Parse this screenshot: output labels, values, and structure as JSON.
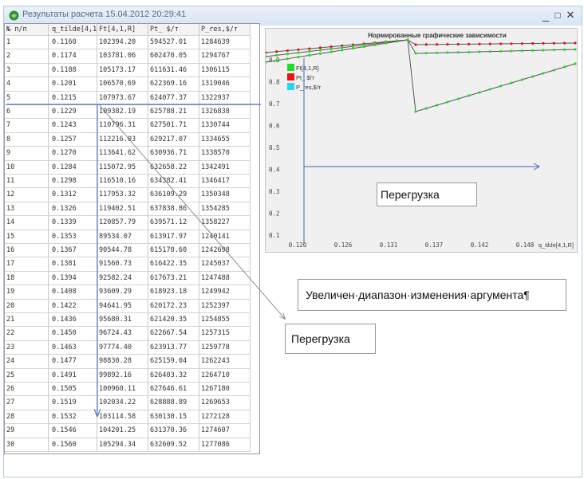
{
  "window": {
    "title": "Результаты расчета 15.04.2012 20:29:41",
    "minimize": "_",
    "maximize": "□",
    "close": "✕"
  },
  "colors": {
    "ft": "#22dd22",
    "pt": "#ee1111",
    "pres": "#22d8ee",
    "chart_bg": "#f0f0f0",
    "line": "#555555"
  },
  "table": {
    "headers": [
      "№ п/п",
      "q_tilde[4,1,R]",
      "Ft[4,1,R]",
      "Pt_ $/т",
      "P_res,$/т"
    ],
    "rows": [
      [
        "1",
        "0.1160",
        "102394.20",
        "594527.01",
        "1284639"
      ],
      [
        "2",
        "0.1174",
        "103781.06",
        "602470.05",
        "1294767"
      ],
      [
        "3",
        "0.1188",
        "105173.17",
        "611631.46",
        "1306115"
      ],
      [
        "4",
        "0.1201",
        "106570.69",
        "622369.16",
        "1319046"
      ],
      [
        "5",
        "0.1215",
        "107973.67",
        "624077.37",
        "1322937"
      ],
      [
        "6",
        "0.1229",
        "109382.19",
        "625788.21",
        "1326838"
      ],
      [
        "7",
        "0.1243",
        "110796.31",
        "627501.71",
        "1330744"
      ],
      [
        "8",
        "0.1257",
        "112216.03",
        "629217.07",
        "1334655"
      ],
      [
        "9",
        "0.1270",
        "113641.62",
        "630936.71",
        "1338570"
      ],
      [
        "10",
        "0.1284",
        "115072.95",
        "632658.22",
        "1342491"
      ],
      [
        "11",
        "0.1298",
        "116510.16",
        "634382.41",
        "1346417"
      ],
      [
        "12",
        "0.1312",
        "117953.32",
        "636109.29",
        "1350348"
      ],
      [
        "13",
        "0.1326",
        "119402.51",
        "637838.86",
        "1354285"
      ],
      [
        "14",
        "0.1339",
        "120857.79",
        "639571.12",
        "1358227"
      ],
      [
        "15",
        "0.1353",
        "89534.07",
        "613917.97",
        "1240141"
      ],
      [
        "16",
        "0.1367",
        "90544.78",
        "615170.60",
        "1242698"
      ],
      [
        "17",
        "0.1381",
        "91560.73",
        "616422.35",
        "1245037"
      ],
      [
        "18",
        "0.1394",
        "92582.24",
        "617673.21",
        "1247488"
      ],
      [
        "19",
        "0.1408",
        "93609.29",
        "618923.18",
        "1249942"
      ],
      [
        "20",
        "0.1422",
        "94641.95",
        "620172.23",
        "1252397"
      ],
      [
        "21",
        "0.1436",
        "95680.31",
        "621420.35",
        "1254855"
      ],
      [
        "22",
        "0.1450",
        "96724.43",
        "622667.54",
        "1257315"
      ],
      [
        "23",
        "0.1463",
        "97774.40",
        "623913.77",
        "1259778"
      ],
      [
        "24",
        "0.1477",
        "98830.28",
        "625159.04",
        "1262243"
      ],
      [
        "25",
        "0.1491",
        "99892.16",
        "626403.32",
        "1264710"
      ],
      [
        "26",
        "0.1505",
        "100960.11",
        "627646.61",
        "1267180"
      ],
      [
        "27",
        "0.1519",
        "102034.22",
        "628888.89",
        "1269653"
      ],
      [
        "28",
        "0.1532",
        "103114.58",
        "630130.15",
        "1272128"
      ],
      [
        "29",
        "0.1546",
        "104201.25",
        "631370.36",
        "1274607"
      ],
      [
        "30",
        "0.1560",
        "105294.34",
        "632609.52",
        "1277086"
      ]
    ]
  },
  "chart_data": {
    "type": "line",
    "title": "Нормированные графические зависимости",
    "xlabel": "q_tilde[4,1,R]",
    "x_ticks": [
      "0.120",
      "0.126",
      "0.131",
      "0.137",
      "0.142",
      "0.148"
    ],
    "y_ticks": [
      "0.9",
      "0.8",
      "0.7",
      "0.6",
      "0.5",
      "0.4",
      "0.3",
      "0.2",
      "0.1"
    ],
    "legend": [
      "Ft[4,1,R]",
      "Pt_ $/т",
      "P_res,$/т"
    ],
    "series": [
      {
        "name": "Ft[4,1,R]",
        "color": "#22dd22"
      },
      {
        "name": "Pt_ $/т",
        "color": "#ee1111"
      },
      {
        "name": "P_res,$/т",
        "color": "#22d8ee"
      }
    ]
  },
  "callouts": {
    "peregruzka_chart": "Перегрузка",
    "diapazon": "Увеличен·диапазон·изменения·аргумента¶",
    "peregruzka_table": "Перегрузка"
  }
}
